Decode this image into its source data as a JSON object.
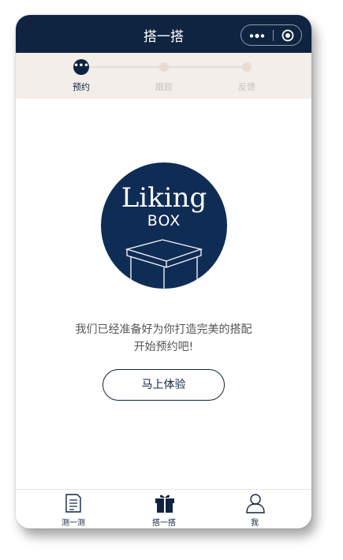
{
  "titlebar": {
    "title": "搭一搭",
    "more_icon": "more-dots-icon",
    "close_icon": "target-close-icon",
    "bg_color": "#0f2440"
  },
  "steps": [
    {
      "label": "预约",
      "active": true
    },
    {
      "label": "跟踪",
      "active": false
    },
    {
      "label": "反馈",
      "active": false
    }
  ],
  "logo": {
    "line1": "Liking",
    "line2": "BOX",
    "icon": "gift-box-icon"
  },
  "message": {
    "line1": "我们已经准备好为你打造完美的搭配",
    "line2": "开始预约吧!"
  },
  "cta_label": "马上体验",
  "tabbar": [
    {
      "label": "测一测",
      "icon": "document-icon"
    },
    {
      "label": "搭一搭",
      "icon": "gift-icon"
    },
    {
      "label": "我",
      "icon": "person-icon"
    }
  ],
  "colors": {
    "accent": "#0f2440",
    "step_bg": "#f3eeea",
    "inactive": "#e8ddd5"
  }
}
